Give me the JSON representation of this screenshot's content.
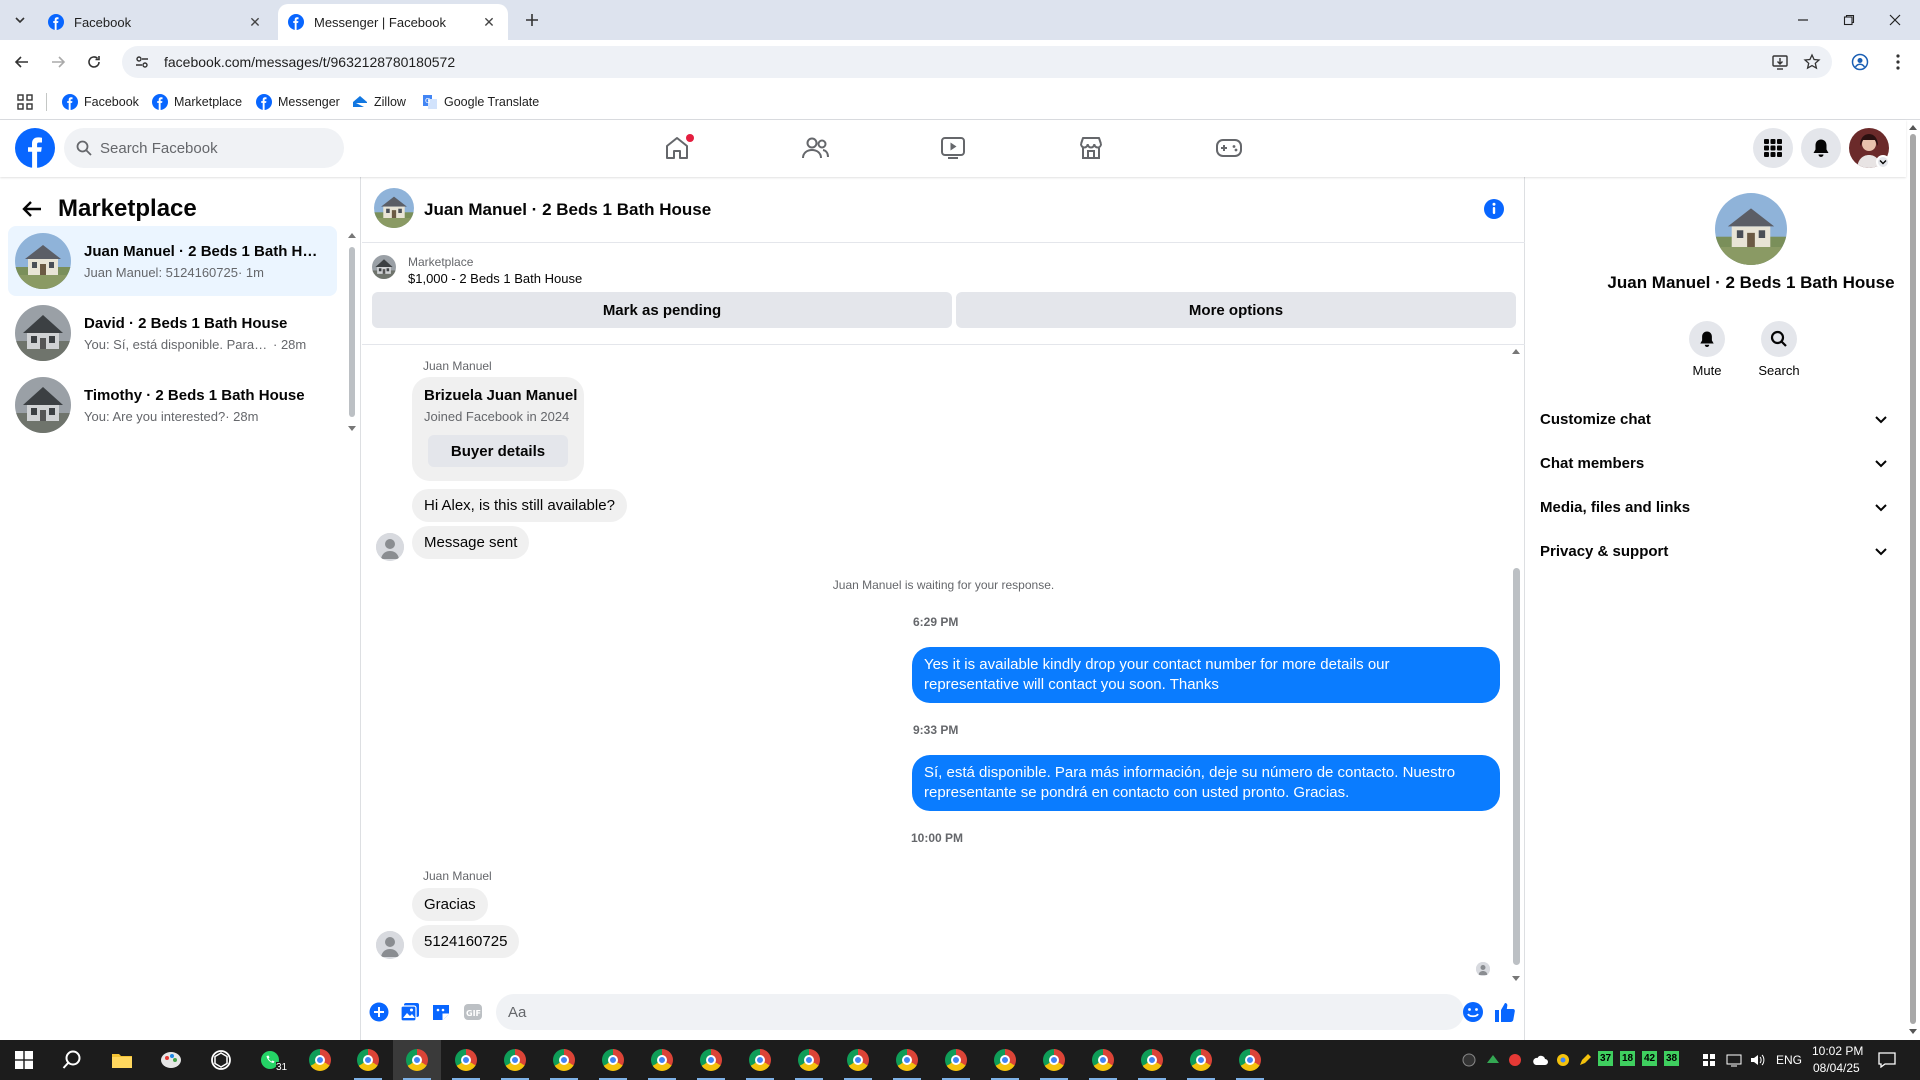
{
  "browser": {
    "tabs": [
      {
        "title": "Facebook",
        "active": false
      },
      {
        "title": "Messenger | Facebook",
        "active": true
      }
    ],
    "url": "facebook.com/messages/t/9632128780180572",
    "bookmarks": [
      "Facebook",
      "Marketplace",
      "Messenger",
      "Zillow",
      "Google Translate"
    ]
  },
  "header": {
    "search_placeholder": "Search Facebook"
  },
  "left_panel": {
    "title": "Marketplace",
    "conversations": [
      {
        "name": "Juan Manuel · 2 Beds 1 Bath House",
        "preview": "Juan Manuel: 5124160725",
        "time": "· 1m",
        "selected": true
      },
      {
        "name": "David · 2 Beds 1 Bath House",
        "preview": "You: Sí, está disponible. Para más información, deje su número de contacto.",
        "time": "· 28m",
        "selected": false
      },
      {
        "name": "Timothy · 2 Beds 1 Bath House",
        "preview": "You: Are you interested?",
        "time": "· 28m",
        "selected": false
      }
    ]
  },
  "chat": {
    "title": "Juan Manuel · 2 Beds 1 Bath House",
    "marketplace_label": "Marketplace",
    "listing": "$1,000 - 2 Beds 1 Bath House",
    "mark_pending": "Mark as pending",
    "more_options": "More options",
    "sender": "Juan Manuel",
    "buyer_card": {
      "name": "Brizuela Juan Manuel",
      "joined": "Joined Facebook in 2024",
      "button": "Buyer details"
    },
    "incoming_1": "Hi Alex, is this still available?",
    "incoming_2": "Message sent",
    "waiting_notice": "Juan Manuel is waiting for your response.",
    "time_1": "6:29 PM",
    "outgoing_1": "Yes it is available kindly drop your contact number for more details our representative will contact you soon. Thanks",
    "time_2": "9:33 PM",
    "outgoing_2": "Sí, está disponible. Para más información, deje su número de contacto. Nuestro representante se pondrá en contacto con usted pronto. Gracias.",
    "time_3": "10:00 PM",
    "sender_2": "Juan Manuel",
    "incoming_3": "Gracias",
    "incoming_4": "5124160725",
    "composer_placeholder": "Aa"
  },
  "right_panel": {
    "title": "Juan Manuel · 2 Beds 1 Bath House",
    "actions": [
      "Mute",
      "Search"
    ],
    "sections": [
      "Customize chat",
      "Chat members",
      "Media, files and links",
      "Privacy & support"
    ]
  },
  "taskbar": {
    "whatsapp_badge": "31",
    "tray_numbers": [
      "37",
      "18",
      "42",
      "38"
    ],
    "language": "ENG",
    "time": "10:02 PM",
    "date": "08/04/25"
  },
  "colors": {
    "fb_blue": "#0866ff",
    "outgoing_bubble": "#0a7cff",
    "selected_row": "#ebf5ff",
    "chrome_tabstrip": "#dde3ee"
  }
}
